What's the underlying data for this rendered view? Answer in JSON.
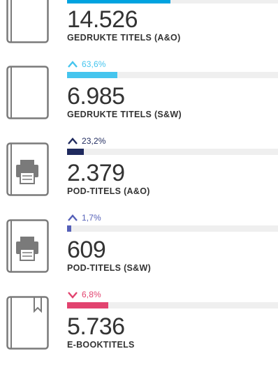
{
  "stats": [
    {
      "icon": "book-icon",
      "change": "",
      "direction": "none",
      "change_color": "#00a3e0",
      "bar_color": "#00a3e0",
      "bar_fraction": 0.49,
      "value": "14.526",
      "label": "GEDRUKTE TITELS (A&O)"
    },
    {
      "icon": "book-icon",
      "change": "63,6%",
      "direction": "up",
      "change_color": "#45c5ee",
      "bar_color": "#45c5ee",
      "bar_fraction": 0.24,
      "value": "6.985",
      "label": "GEDRUKTE TITELS (S&W)"
    },
    {
      "icon": "printer-book-icon",
      "change": "23,2%",
      "direction": "up",
      "change_color": "#1f2a5e",
      "bar_color": "#1f2a5e",
      "bar_fraction": 0.08,
      "value": "2.379",
      "label": "POD-TITELS (A&O)"
    },
    {
      "icon": "printer-book-icon",
      "change": "1,7%",
      "direction": "up",
      "change_color": "#5560b8",
      "bar_color": "#5560b8",
      "bar_fraction": 0.02,
      "value": "609",
      "label": "POD-TITELS (S&W)"
    },
    {
      "icon": "ebook-icon",
      "change": "6,8%",
      "direction": "down",
      "change_color": "#e2436f",
      "bar_color": "#e2436f",
      "bar_fraction": 0.195,
      "value": "5.736",
      "label": "E-BOOKTITELS"
    }
  ]
}
